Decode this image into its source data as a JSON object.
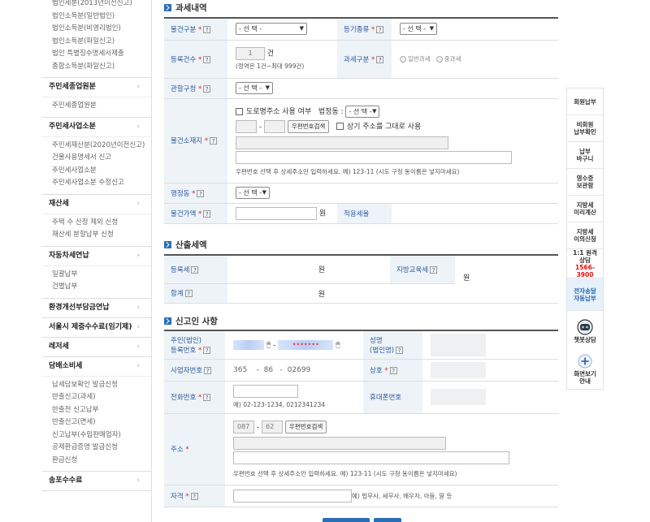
{
  "sidebar": {
    "groups": [
      {
        "head": "",
        "subs": [
          "법인세분(2013년이전신고)",
          "법인소득분(일반법인)",
          "법인소득분(비영리법인)",
          "법인소득분(파일신고)",
          "법인 특별징수명세서제출",
          "종합소득분(파일신고)"
        ]
      },
      {
        "head": "주민세종업원분",
        "subs": [
          "주민세종업원분"
        ]
      },
      {
        "head": "주민세사업소분",
        "subs": [
          "주민세재산분(2020년이전신고)",
          "건물사용명세서 신고",
          "주민세사업소분",
          "주민세사업소분 수정신고"
        ]
      },
      {
        "head": "재산세",
        "subs": [
          "주택 수 산정 제외 신청",
          "재산세 분할납부 신청"
        ]
      },
      {
        "head": "자동차세연납",
        "subs": [
          "일괄납부",
          "건별납부"
        ]
      },
      {
        "head": "환경개선부담금연납",
        "subs": []
      },
      {
        "head": "서울시 제증수수료(임기제)",
        "subs": []
      },
      {
        "head": "레저세",
        "subs": []
      },
      {
        "head": "담배소비세",
        "subs": [
          "납세담보확인 발급신청",
          "반출신고(과세)",
          "반출전 신고납부",
          "반출신고(면세)",
          "신고납부(수입판매업자)",
          "공제환급증명 발급신청",
          "환급신청"
        ]
      },
      {
        "head": "송포수수료",
        "subs": []
      }
    ],
    "chevron": "›"
  },
  "sections": {
    "tax": "과세내역",
    "calc": "산출세액",
    "reporter": "신고인 사항"
  },
  "tax": {
    "item_type_label": "물건구분",
    "item_type_value": "- 선 택 -",
    "reg_type_label": "등기종류",
    "reg_type_value": "- 선 택 -",
    "reg_count_label": "등록건수",
    "reg_count_value": "1",
    "reg_count_unit": "건",
    "reg_count_hint": "(정역은 1건~최대 999건)",
    "tax_type_label": "과세구분",
    "tax_type_opt1": "일반과세",
    "tax_type_opt2": "중과세",
    "office_label": "관할구청",
    "office_value": "- 선 택 -",
    "location_label": "물건소재지",
    "road_addr_label": "도로명주소 사용 여부",
    "legal_dong_label": "법정동 :",
    "legal_dong_value": "- 선 택 -",
    "zip_search": "우편번호검색",
    "same_addr_label": "상기 주소를 그대로 사용",
    "addr_hint": "우편번호 선택 후 상세주소만 입력하세요. 예) 123-11 (시도 구청 동이름은 넣지마세요)",
    "admin_dong_label": "행정동",
    "admin_dong_value": "- 선 택 -",
    "price_label": "물건가액",
    "price_unit": "원",
    "rate_label": "적용세율"
  },
  "calc": {
    "reg_tax_label": "등록세",
    "reg_tax_unit": "원",
    "edu_tax_label": "지방교육세",
    "edu_tax_unit": "원",
    "total_label": "합계",
    "total_unit": "원"
  },
  "reporter": {
    "resident_label_1": "주민(법인)",
    "resident_label_2": "등록번호",
    "name_label_1": "성명",
    "name_label_2": "(법인명)",
    "biz_no_label": "사업자번호",
    "biz_no_1": "365",
    "biz_no_2": "86",
    "biz_no_3": "02699",
    "trade_name_label": "상호",
    "phone_label": "전화번호",
    "phone_hint": "예) 02-123-1234, 0212341234",
    "mobile_label": "휴대폰번호",
    "address_label": "주소",
    "zip1": "087",
    "zip2": "62",
    "zip_search": "우편번호검색",
    "addr_hint": "우편번호 선택 후 상세주소만 입력하세요. 예) 123-11 (시도 구청 동이름은 넣지마세요)",
    "qual_label": "자격",
    "qual_hint": "예) 법무사, 세무사, 배우자, 아들, 딸 등",
    "dash": "-"
  },
  "quick_menu": {
    "items": [
      "회원납부",
      "비회원\n납부확인",
      "납부\n바구니",
      "영수증\n보관함",
      "지방세\n미리계산",
      "지방세\n이의신청"
    ],
    "consult_1": "1:1 원격",
    "consult_2": "상담",
    "consult_phone": "1566-3900",
    "e_delivery_1": "전자송달",
    "e_delivery_2": "자동납부",
    "chatbot": "챗봇상담",
    "zoom_1": "화면보기",
    "zoom_2": "안내"
  },
  "icons": {
    "help": "?",
    "mouse": "🖱"
  }
}
